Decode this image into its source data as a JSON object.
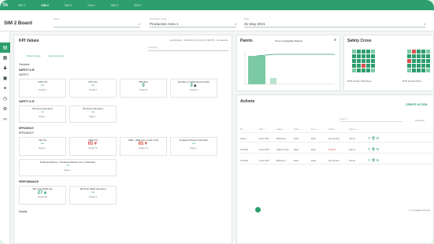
{
  "nav": {
    "tabs": [
      "SIM 1",
      "SIM 2",
      "SIM 3",
      "SIM 4",
      "SIM 5",
      "SIM 6"
    ],
    "active_index": 1
  },
  "header": {
    "board_title": "SIM 2 Board",
    "team_placeholder": "Team",
    "area_label": "Production area",
    "area_value": "Production Area 1",
    "date_label": "Date",
    "date_value": "31 May 2021"
  },
  "kpi": {
    "title": "KPI Values",
    "refresh_info": "Last Refresh : 2021-05-31 10:11:29 | LSB KPI - No selection",
    "category_placeholder": "Category",
    "show_scores": "Show Scores",
    "external_links": "External Links",
    "overview": "Overview",
    "safety_ie": "SAFETY & IE",
    "safety": "SAFETY",
    "safety_ie2": "SAFETY & IE",
    "efficiency": "EFFICIENCY",
    "efficiency2": "EFFICIENCY",
    "performance": "PERFORMANCE",
    "details": "Details",
    "boxes": [
      {
        "name": "LTIR (%)",
        "value": "--",
        "target": "Target 0"
      },
      {
        "name": "LTIF (%)",
        "value": "--",
        "target": "Target 0"
      },
      {
        "name": "NM (Nb)",
        "value": "0",
        "target": "Target 0"
      },
      {
        "name": "Number of Safety Events (Nb)",
        "value": "3",
        "target": "Target 0",
        "arrow": "up"
      },
      {
        "name": "5S Score (Number)",
        "value": "--",
        "target": "Target --"
      },
      {
        "name": "5S Score (Number)",
        "value": "--",
        "target": "Target --"
      },
      {
        "name": "OE (%)",
        "value": "--",
        "target": "Target --"
      },
      {
        "name": "OEE (%)",
        "value": "65",
        "target": "Target 70",
        "arrow": "down"
      },
      {
        "name": "OEE - OEE Line 1 and 2 (%)",
        "value": "65",
        "target": "Target 70",
        "arrow": "down"
      },
      {
        "name": "Produced Pieces (Number)",
        "value": "--",
        "target": "Target --"
      },
      {
        "name": "Produced Pieces - Produced Pieces Line 1 (Number)",
        "value": "--",
        "target": "Target --"
      },
      {
        "name": "SPI 4 for SIM2 (%)",
        "value": "27",
        "target": "Target 80",
        "arrow": "up"
      },
      {
        "name": "SPI B for SIM2 (Number)",
        "value": "--",
        "target": "Target 4"
      }
    ]
  },
  "pareto": {
    "title": "Pareto",
    "subtitle": "Time Loss/Quality Defects"
  },
  "safety_cross": {
    "title": "Safety Cross",
    "label1": "MTD Incident Third Area",
    "label2": "MTD Incident Plant"
  },
  "actions": {
    "title": "Actions",
    "create": "CREATE ACTION",
    "search": "Search",
    "columns": "Columns",
    "footer": "1 of 1 pages (3 items)",
    "rows": [
      {
        "id": "Action",
        "area": "action title",
        "type": "Efficiency",
        "start": "Date",
        "due": "Date",
        "status": "Not started",
        "owner": "Owner"
      },
      {
        "id": "07-2021",
        "area": "Area OPP",
        "type": "Safety & HH",
        "start": "Date",
        "due": "Date",
        "status": "Started",
        "owner": "Owner"
      },
      {
        "id": "07-2021",
        "area": "Area OPP",
        "type": "Efficiency",
        "start": "Date",
        "due": "Date",
        "status": "Not started",
        "owner": "Owner"
      }
    ]
  },
  "colors": {
    "accent": "#2e9e6e",
    "danger": "#d9534f"
  }
}
